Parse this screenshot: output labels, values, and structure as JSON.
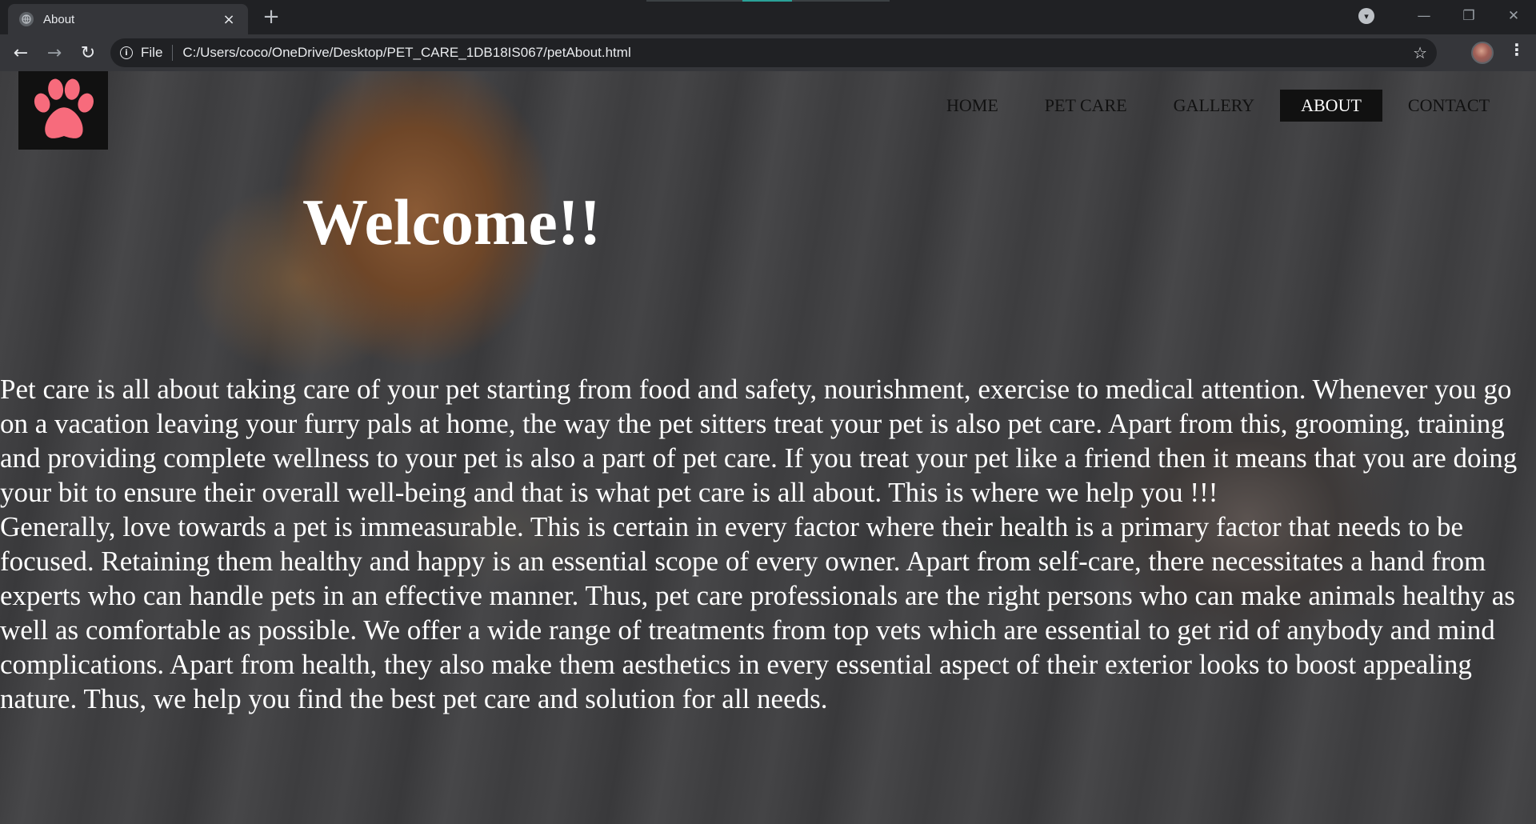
{
  "browser": {
    "tab_title": "About",
    "tab_close": "×",
    "new_tab": "+",
    "scheme_label": "File",
    "url": "C:/Users/coco/OneDrive/Desktop/PET_CARE_1DB18IS067/petAbout.html",
    "back_glyph": "←",
    "forward_glyph": "→",
    "reload_glyph": "↻",
    "star_glyph": "☆",
    "menu_glyph": "⋮",
    "minimize_glyph": "—",
    "restore_glyph": "❐",
    "close_glyph": "✕",
    "profile_glyph": "▾"
  },
  "site": {
    "nav": [
      {
        "label": "HOME",
        "active": false
      },
      {
        "label": "PET CARE",
        "active": false
      },
      {
        "label": "GALLERY",
        "active": false
      },
      {
        "label": "ABOUT",
        "active": true
      },
      {
        "label": "CONTACT",
        "active": false
      }
    ],
    "heading": "Welcome!!",
    "paragraphs": [
      "Pet care is all about taking care of your pet starting from food and safety, nourishment, exercise to medical attention. Whenever you go on a vacation leaving your furry pals at home, the way the pet sitters treat your pet is also pet care. Apart from this, grooming, training and providing complete wellness to your pet is also a part of pet care. If you treat your pet like a friend then it means that you are doing your bit to ensure their overall well-being and that is what pet care is all about. This is where we help you !!!",
      "Generally, love towards a pet is immeasurable. This is certain in every factor where their health is a primary factor that needs to be focused. Retaining them healthy and happy is an essential scope of every owner. Apart from self-care, there necessitates a hand from experts who can handle pets in an effective manner. Thus, pet care professionals are the right persons who can make animals healthy as well as comfortable as possible. We offer a wide range of treatments from top vets which are essential to get rid of anybody and mind complications. Apart from health, they also make them aesthetics in every essential aspect of their exterior looks to boost appealing nature. Thus, we help you find the best pet care and solution for all needs."
    ]
  },
  "colors": {
    "paw": "#f76b7c",
    "logo_bg": "#111111",
    "active_nav_bg": "#111111",
    "text": "#ffffff"
  }
}
